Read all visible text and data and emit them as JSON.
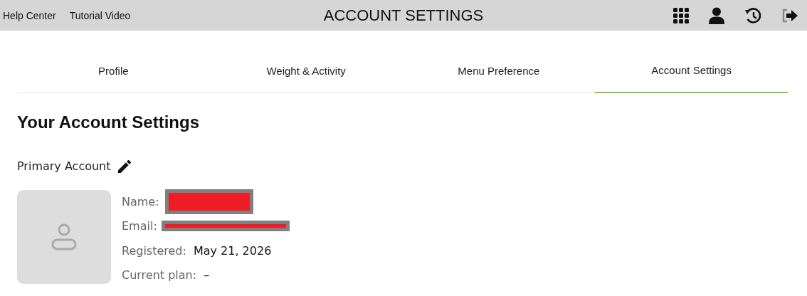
{
  "header": {
    "links": [
      "Help Center",
      "Tutorial Video"
    ],
    "title": "ACCOUNT SETTINGS"
  },
  "tabs": [
    {
      "label": "Profile",
      "selected": false
    },
    {
      "label": "Weight & Activity",
      "selected": false
    },
    {
      "label": "Menu Preference",
      "selected": false
    },
    {
      "label": "Account Settings",
      "selected": true
    }
  ],
  "heading": "Your Account Settings",
  "section": {
    "title": "Primary Account"
  },
  "fields": [
    {
      "label": "Name:",
      "redacted": true,
      "kind": "block"
    },
    {
      "label": "Email:",
      "redacted": true,
      "kind": "line"
    },
    {
      "label": "Registered:",
      "value": "May 21, 2026",
      "redacted": false
    },
    {
      "label": "Current plan:",
      "value": "–",
      "redacted": false
    }
  ]
}
